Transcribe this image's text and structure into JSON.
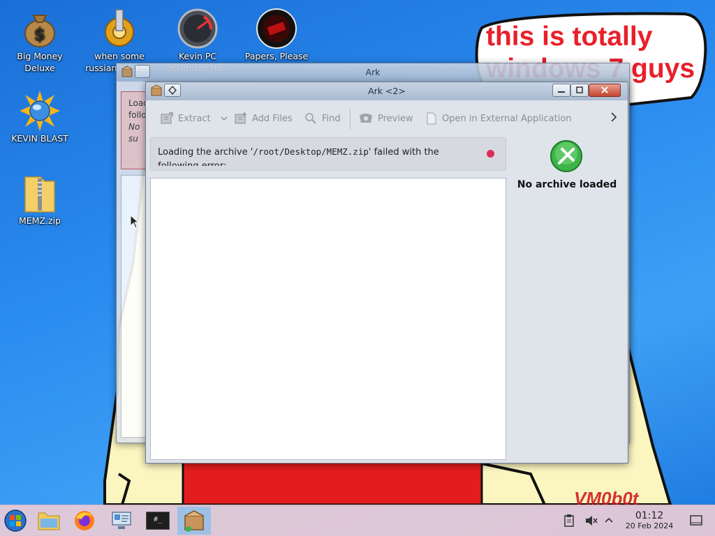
{
  "desktop": {
    "icons": [
      {
        "label": "Big Money Deluxe",
        "icon": "money-bag-icon"
      },
      {
        "label": "when some russian hackers",
        "icon": "gear-icon"
      },
      {
        "label": "Kevin PC Optimizer Ho...",
        "icon": "speedometer-icon"
      },
      {
        "label": "Papers, Please",
        "icon": "papers-please-icon"
      },
      {
        "label": "KEVIN BLAST",
        "icon": "globe-burst-icon"
      },
      {
        "label": "MEMZ.zip",
        "icon": "zip-folder-icon"
      }
    ],
    "bubble_text": "this is totally windows 7 guys",
    "watermark": "VM0b0t"
  },
  "back_window": {
    "title": "Ark",
    "toolbar": [
      "Extract",
      "Add Files",
      "Find",
      "Preview",
      "Open in External Application"
    ],
    "message_fragments": [
      "Load",
      "follo",
      "No su"
    ]
  },
  "front_window": {
    "title": "Ark <2>",
    "toolbar": {
      "extract": "Extract",
      "add_files": "Add Files",
      "find": "Find",
      "preview": "Preview",
      "open_external": "Open in External Application"
    },
    "message": {
      "prefix": "Loading the archive '",
      "path": "/root/Desktop/MEMZ.zip",
      "suffix": "' failed with the following error:"
    },
    "side_panel": {
      "status": "No archive loaded"
    }
  },
  "taskbar": {
    "items": [
      "start-orb-icon",
      "file-manager-icon",
      "firefox-icon",
      "system-settings-icon",
      "terminal-icon",
      "ark-icon"
    ],
    "terminal_glyph": "#_",
    "clock": {
      "time": "01:12",
      "date": "20 Feb 2024"
    }
  },
  "colors": {
    "accent": "#2a8bef",
    "bubble_text": "#e8202a",
    "error_dot": "#dc2d5a",
    "taskbar": "#ecccd6"
  }
}
